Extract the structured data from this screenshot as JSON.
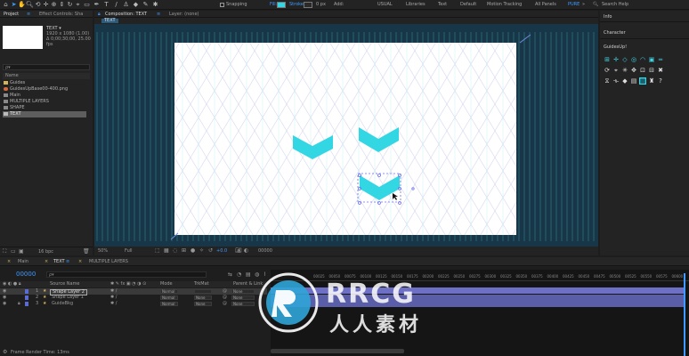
{
  "toolbar": {
    "snapping_label": "Snapping",
    "fill_label": "Fill:",
    "stroke_label": "Stroke:",
    "stroke_width": "0 px",
    "add_label": "Add:",
    "fill_color": "#33d6e3",
    "workspaces": [
      "USUAL",
      "Libraries",
      "Text",
      "Default",
      "Motion Tracking",
      "All Panels"
    ],
    "active_workspace": "PURE",
    "search_help": "Search Help"
  },
  "project_panel": {
    "tab_project": "Project",
    "tab_effect_controls": "Effect Controls: Sha",
    "selected_name": "TEXT ▾",
    "selected_info_1": "1920 x 1080 (1.00)",
    "selected_info_2": "Δ 0;00;30;00, 25.00 fps",
    "search_placeholder": "ρ▾",
    "column_name": "Name",
    "items": [
      {
        "name": "Guides",
        "type": "folder"
      },
      {
        "name": "GuidesUpBase00-400.png",
        "type": "image"
      },
      {
        "name": "Main",
        "type": "comp"
      },
      {
        "name": "MULTIPLE LAYERS",
        "type": "comp"
      },
      {
        "name": "SHAPE",
        "type": "comp"
      },
      {
        "name": "TEXT",
        "type": "comp",
        "selected": true
      }
    ],
    "bpc_label": "16 bpc"
  },
  "composition": {
    "tab_label": "Composition: TEXT",
    "layer_tab": "Layer: (none)",
    "breadcrumb": "TEXT",
    "zoom": "50%",
    "resolution": "Full",
    "exposure": "+0.0",
    "timecode": "00000"
  },
  "right_panel": {
    "info_label": "Info",
    "character_label": "Character",
    "guides_label": "GuidesUp!"
  },
  "timeline": {
    "tabs": [
      "Main",
      "TEXT",
      "MULTIPLE LAYERS"
    ],
    "active_tab": "TEXT",
    "current_time": "00000",
    "search_placeholder": "ρ▾",
    "columns": {
      "source_name": "Source Name",
      "mode": "Mode",
      "trkmat": "TrkMat",
      "parent": "Parent & Link"
    },
    "layers": [
      {
        "num": "1",
        "name": "Shape Layer 2",
        "mode": "Normal",
        "trkmat": "",
        "parent": "None",
        "selected": true
      },
      {
        "num": "2",
        "name": "Shape Layer 1",
        "mode": "Normal",
        "trkmat": "None",
        "parent": "None",
        "selected": false
      },
      {
        "num": "3",
        "name": "GuideBkg",
        "mode": "Normal",
        "trkmat": "None",
        "parent": "None",
        "selected": false
      }
    ],
    "ruler": [
      "00025",
      "00050",
      "00075",
      "00100",
      "00125",
      "00150",
      "00175",
      "00200",
      "00225",
      "00250",
      "00275",
      "00300",
      "00325",
      "00350",
      "00375",
      "00400",
      "00425",
      "00450",
      "00475",
      "00500",
      "00525",
      "00550",
      "00575",
      "00600"
    ],
    "status": "Frame Render Time: 13ms"
  },
  "watermark": {
    "brand": "RRCG",
    "subtitle": "人人素材"
  }
}
